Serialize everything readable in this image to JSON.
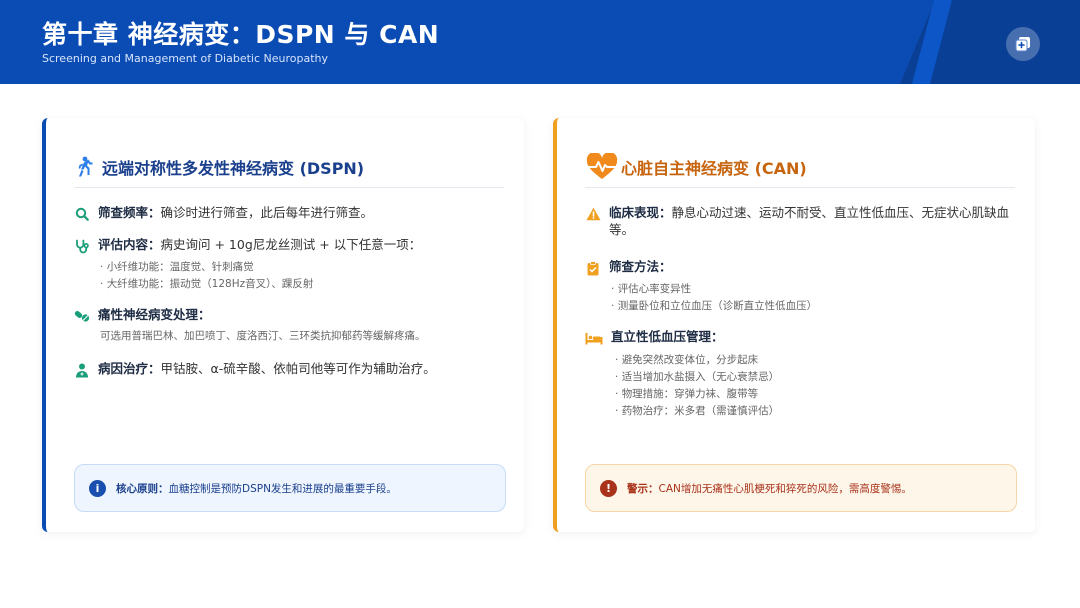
{
  "header": {
    "title": "第十章 神经病变：DSPN 与 CAN",
    "subtitle": "Screening and Management of Diabetic Neuropathy",
    "icon": "copy-add-icon"
  },
  "dspn": {
    "title": "远端对称性多发性神经病变 (DSPN)",
    "icon": "walking-person-icon",
    "accent": "#0b4cb4",
    "screening": {
      "label": "筛查频率：",
      "text": "确诊时进行筛查，此后每年进行筛查。"
    },
    "assessment": {
      "label": "评估内容：",
      "text": "病史询问 + 10g尼龙丝测试 + 以下任意一项：",
      "subs": [
        "小纤维功能：温度觉、针刺痛觉",
        "大纤维功能：振动觉（128Hz音叉）、踝反射"
      ]
    },
    "pain": {
      "label": "痛性神经病变处理：",
      "text": "可选用普瑞巴林、加巴喷丁、度洛西汀、三环类抗抑郁药等缓解疼痛。"
    },
    "etiology": {
      "label": "病因治疗：",
      "text": "甲钴胺、α-硫辛酸、依帕司他等可作为辅助治疗。"
    },
    "notice": {
      "label": "核心原则：",
      "text": "血糖控制是预防DSPN发生和进展的最重要手段。"
    }
  },
  "can": {
    "title": "心脏自主神经病变 (CAN)",
    "icon": "heartbeat-icon",
    "accent": "#f0a020",
    "clinical": {
      "label": "临床表现：",
      "text": "静息心动过速、运动不耐受、直立性低血压、无症状心肌缺血等。"
    },
    "screening": {
      "label": "筛查方法：",
      "subs": [
        "评估心率变异性",
        "测量卧位和立位血压（诊断直立性低血压）"
      ]
    },
    "hypotension": {
      "label": "直立性低血压管理：",
      "subs": [
        "避免突然改变体位，分步起床",
        "适当增加水盐摄入（无心衰禁忌）",
        "物理措施：穿弹力袜、腹带等",
        "药物治疗：米多君（需谨慎评估）"
      ]
    },
    "notice": {
      "label": "警示：",
      "text": "CAN增加无痛性心肌梗死和猝死的风险，需高度警惕。"
    }
  },
  "bullet": "·"
}
